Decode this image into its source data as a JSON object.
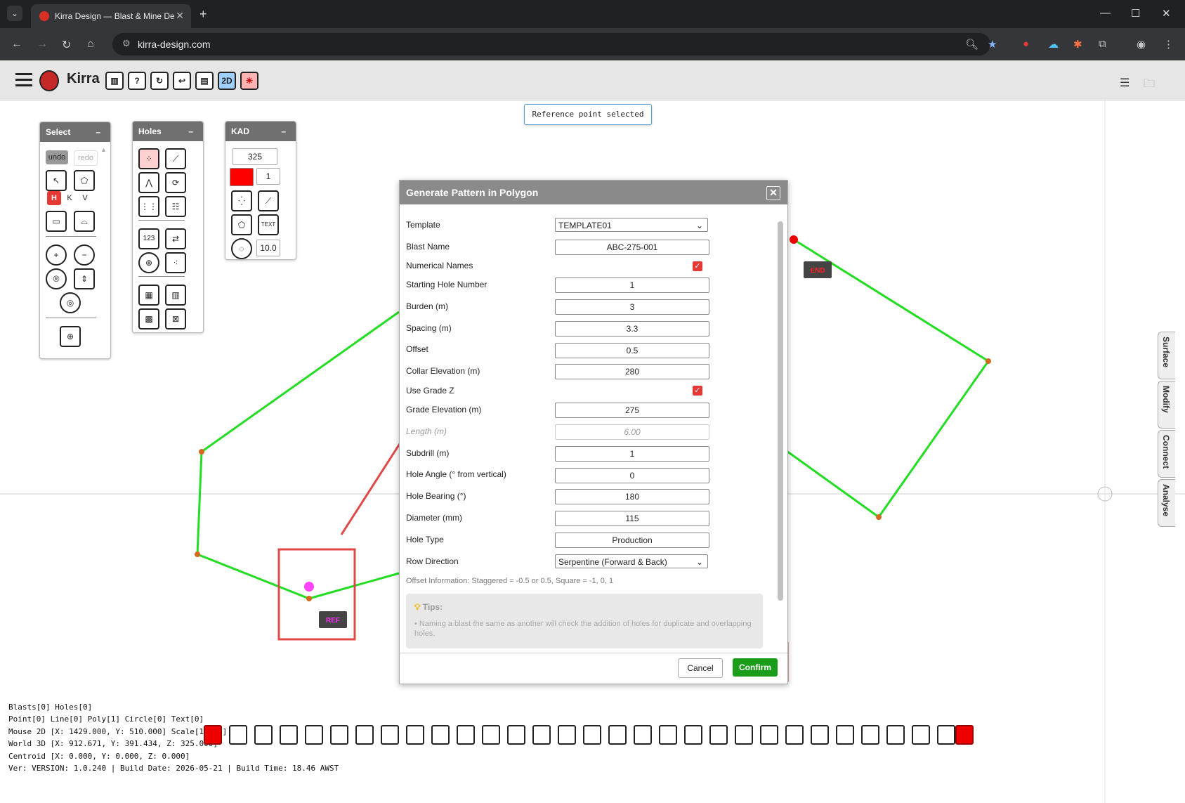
{
  "browser": {
    "tab_title": "Kirra Design — Blast & Mine De",
    "url": "kirra-design.com"
  },
  "app": {
    "name": "Kirra",
    "toast": "Reference point selected"
  },
  "panels": {
    "select": {
      "title": "Select",
      "undo": "undo",
      "redo": "redo",
      "h": "H",
      "k": "K",
      "v": "V"
    },
    "holes": {
      "title": "Holes"
    },
    "kad": {
      "title": "KAD",
      "value1": "325",
      "value2": "1",
      "value3": "10.0",
      "color": "#ff0000"
    }
  },
  "canvas": {
    "ref_label": "REF",
    "end_label": "END",
    "polygon_color": "#22dd22"
  },
  "dialog": {
    "title": "Generate Pattern in Polygon",
    "fields": [
      {
        "label": "Template",
        "value": "TEMPLATE01"
      },
      {
        "label": "Blast Name",
        "value": "ABC-275-001"
      },
      {
        "label": "Numerical Names",
        "value": "checked"
      },
      {
        "label": "Starting Hole Number",
        "value": "1"
      },
      {
        "label": "Burden (m)",
        "value": "3"
      },
      {
        "label": "Spacing (m)",
        "value": "3.3"
      },
      {
        "label": "Offset",
        "value": "0.5"
      },
      {
        "label": "Collar Elevation (m)",
        "value": "280"
      },
      {
        "label": "Use Grade Z",
        "value": "checked"
      },
      {
        "label": "Grade Elevation (m)",
        "value": "275"
      },
      {
        "label": "Length (m)",
        "value": "6.00"
      },
      {
        "label": "Subdrill (m)",
        "value": "1"
      },
      {
        "label": "Hole Angle (° from vertical)",
        "value": "0"
      },
      {
        "label": "Hole Bearing (°)",
        "value": "180"
      },
      {
        "label": "Diameter (mm)",
        "value": "115"
      },
      {
        "label": "Hole Type",
        "value": "Production"
      },
      {
        "label": "Row Direction",
        "value": "Serpentine (Forward & Back)"
      }
    ],
    "offset_info": "Offset Information: Staggered = -0.5 or 0.5, Square = -1, 0, 1",
    "tips_title": "Tips:",
    "tips_text": "• Naming a blast the same as another will check the addition of holes for duplicate and overlapping holes.",
    "cancel": "Cancel",
    "confirm": "Confirm"
  },
  "side_tabs": [
    "Surface",
    "Modify",
    "Connect",
    "Analyse"
  ],
  "status": {
    "line1": "Blasts[0] Holes[0]",
    "line2": "Point[0] Line[0] Poly[1] Circle[0] Text[0]",
    "line3": "Mouse 2D [X: 1429.000, Y: 510.000] Scale[1:440]",
    "line4": "World 3D [X: 912.671, Y: 391.434, Z: 325.000]",
    "line5": "Centroid [X: 0.000, Y: 0.000, Z: 0.000]",
    "line6": "Ver: VERSION: 1.0.240 | Build Date: 2026-05-21 | Build Time: 18.46 AWST"
  }
}
